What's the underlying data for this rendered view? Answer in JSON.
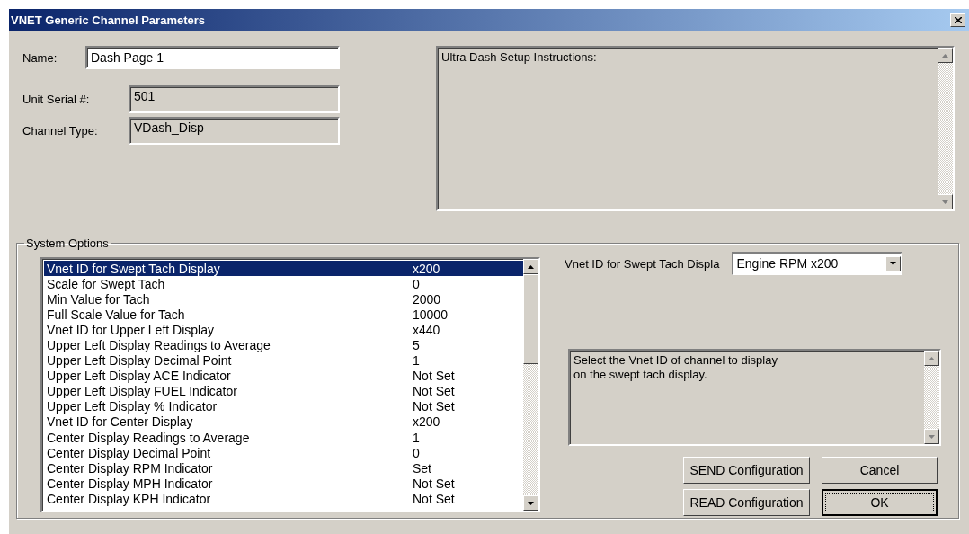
{
  "window": {
    "title": "VNET Generic Channel Parameters"
  },
  "fields": [
    {
      "label": "Name:",
      "value": "Dash Page 1",
      "editable": true
    },
    {
      "label": "Unit Serial #:",
      "value": "501",
      "editable": false
    },
    {
      "label": "Channel Type:",
      "value": "VDash_Disp",
      "editable": false
    }
  ],
  "instructions": {
    "text": "Ultra Dash Setup Instructions:"
  },
  "system_options": {
    "title": "System Options",
    "rows": [
      {
        "label": "Vnet ID for Swept Tach Display",
        "value": "x200",
        "selected": true
      },
      {
        "label": "Scale for Swept Tach",
        "value": "0",
        "selected": false
      },
      {
        "label": "Min Value for Tach",
        "value": "2000",
        "selected": false
      },
      {
        "label": "Full Scale Value for Tach",
        "value": "10000",
        "selected": false
      },
      {
        "label": "Vnet ID for Upper Left Display",
        "value": "x440",
        "selected": false
      },
      {
        "label": "Upper Left Display Readings to Average",
        "value": "5",
        "selected": false
      },
      {
        "label": "Upper Left Display Decimal Point",
        "value": "1",
        "selected": false
      },
      {
        "label": "Upper Left Display ACE Indicator",
        "value": "Not Set",
        "selected": false
      },
      {
        "label": "Upper Left Display FUEL Indicator",
        "value": "Not Set",
        "selected": false
      },
      {
        "label": "Upper Left Display % Indicator",
        "value": "Not Set",
        "selected": false
      },
      {
        "label": "Vnet ID for Center Display",
        "value": "x200",
        "selected": false
      },
      {
        "label": "Center Display  Readings to Average",
        "value": "1",
        "selected": false
      },
      {
        "label": "Center Display Decimal Point",
        "value": "0",
        "selected": false
      },
      {
        "label": "Center Display RPM Indicator",
        "value": "Set",
        "selected": false
      },
      {
        "label": "Center Display MPH Indicator",
        "value": "Not Set",
        "selected": false
      },
      {
        "label": "Center Display KPH Indicator",
        "value": "Not Set",
        "selected": false
      }
    ],
    "parameter": {
      "label": "Vnet ID for Swept Tach Displa",
      "value": "Engine RPM x200"
    },
    "description": "Select the Vnet ID of channel to display\non the swept tach display.",
    "buttons": [
      {
        "label": "SEND Configuration",
        "default": false
      },
      {
        "label": "Cancel",
        "default": false
      },
      {
        "label": "READ Configuration",
        "default": false
      },
      {
        "label": "OK",
        "default": true
      }
    ]
  }
}
